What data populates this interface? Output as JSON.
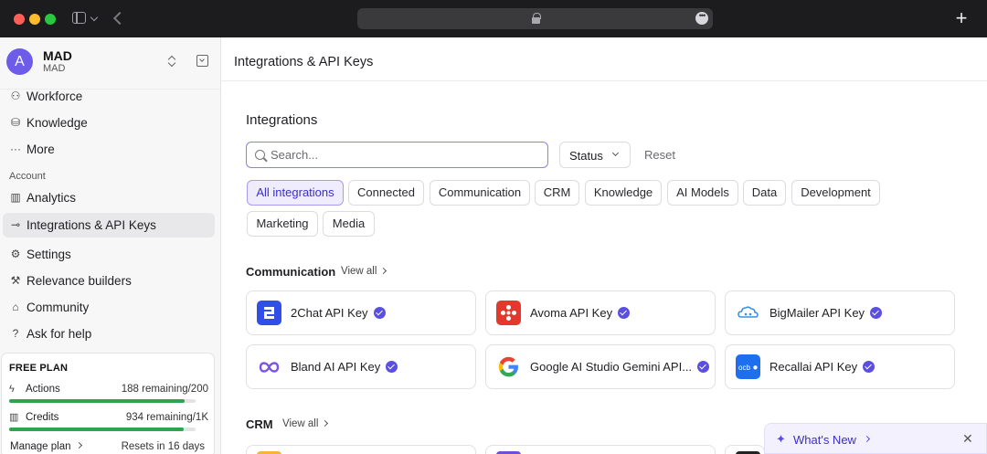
{
  "browser": {
    "new_tab_glyph": "+",
    "more_glyph": "•••"
  },
  "workspace": {
    "avatar_letter": "A",
    "name": "MAD",
    "subtitle": "MAD"
  },
  "sidebar": {
    "items": [
      {
        "label": "Workforce",
        "icon": "⚇"
      },
      {
        "label": "Knowledge",
        "icon": "⛁"
      },
      {
        "label": "More",
        "icon": "···"
      },
      {
        "label": "Analytics",
        "icon": "▥"
      },
      {
        "label": "Integrations & API Keys",
        "icon": "⊸"
      },
      {
        "label": "Settings",
        "icon": "⚙"
      },
      {
        "label": "Relevance builders",
        "icon": "⚒"
      },
      {
        "label": "Community",
        "icon": "⌂"
      },
      {
        "label": "Ask for help",
        "icon": "?"
      }
    ],
    "section_account": "Account"
  },
  "plan": {
    "title": "FREE PLAN",
    "actions_label": "Actions",
    "actions_value": "188 remaining/200",
    "actions_fraction": 0.94,
    "credits_label": "Credits",
    "credits_value": "934 remaining/1K",
    "credits_fraction": 0.934,
    "manage_label": "Manage plan",
    "resets_label": "Resets in 16 days"
  },
  "main": {
    "page_title": "Integrations & API Keys",
    "section_title": "Integrations",
    "search_placeholder": "Search...",
    "status_label": "Status",
    "reset_label": "Reset",
    "filters": [
      "All integrations",
      "Connected",
      "Communication",
      "CRM",
      "Knowledge",
      "AI Models",
      "Data",
      "Development",
      "Marketing",
      "Media"
    ],
    "communication": {
      "title": "Communication",
      "view_all": "View all",
      "cards": [
        {
          "name": "2Chat API Key",
          "color": "#2f4fe8"
        },
        {
          "name": "Avoma API Key",
          "color": "#e5382d"
        },
        {
          "name": "BigMailer API Key",
          "color": "#3b8fe0"
        },
        {
          "name": "Bland AI API Key",
          "color": "#7a55e6"
        },
        {
          "name": "Google AI Studio Gemini API...",
          "color": "#4285f4"
        },
        {
          "name": "Recallai API Key",
          "color": "#1e6ff0"
        }
      ]
    },
    "crm": {
      "title": "CRM",
      "view_all": "View all"
    }
  },
  "whats_new": {
    "label": "What's New",
    "spark": "✦",
    "close": "✕"
  }
}
